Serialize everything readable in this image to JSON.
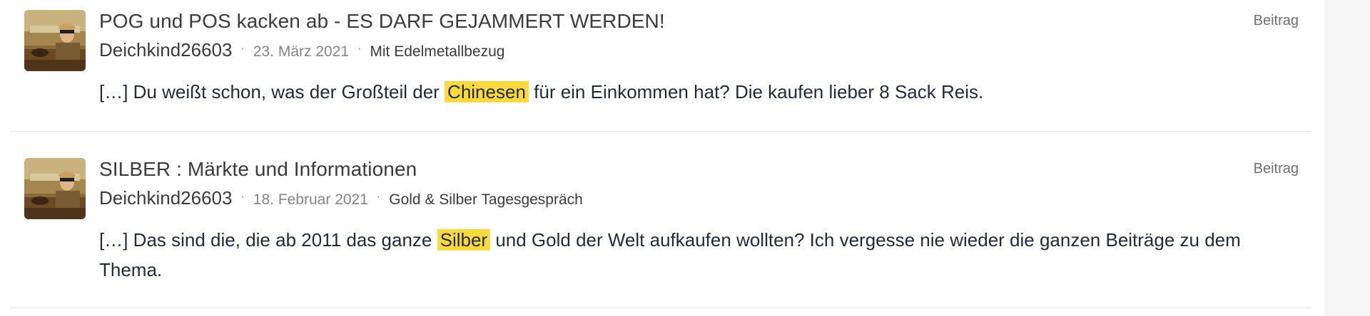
{
  "results": [
    {
      "title": "POG und POS kacken ab - ES DARF GEJAMMERT WERDEN!",
      "type": "Beitrag",
      "author": "Deichkind26603",
      "separator": "·",
      "date": "23. März 2021",
      "forum": "Mit Edelmetallbezug",
      "snippet_before": "[…] Du weißt schon, was der Großteil der ",
      "snippet_highlight": "Chinesen",
      "snippet_after": " für ein Einkommen hat? Die kaufen lieber 8 Sack Reis.",
      "avatar_icon": "user-avatar-car-photo"
    },
    {
      "title": "SILBER : Märkte und Informationen",
      "type": "Beitrag",
      "author": "Deichkind26603",
      "separator": "·",
      "date": "18. Februar 2021",
      "forum": "Gold & Silber Tagesgespräch",
      "snippet_before": "[…] Das sind die, die ab 2011 das ganze ",
      "snippet_highlight": "Silber",
      "snippet_after": " und Gold der Welt aufkaufen wollten? Ich vergesse nie wieder die ganzen Beiträge zu dem Thema.",
      "avatar_icon": "user-avatar-car-photo"
    }
  ],
  "colors": {
    "highlight": "#ffd93d",
    "text": "#1f2a3a",
    "muted": "#858585",
    "divider": "#dfdfdf"
  }
}
